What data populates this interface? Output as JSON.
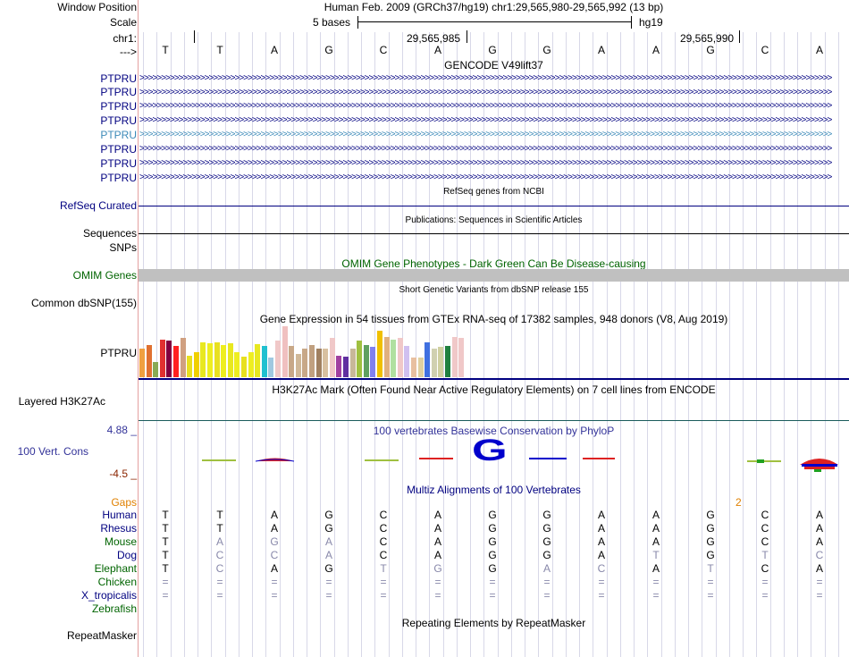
{
  "labels": {
    "window_position": "Window Position",
    "scale": "Scale",
    "chrom": "chr1:",
    "strand": "--->",
    "gencode_items": [
      "PTPRU",
      "PTPRU",
      "PTPRU",
      "PTPRU",
      "PTPRU",
      "PTPRU",
      "PTPRU",
      "PTPRU"
    ],
    "refseq": "RefSeq Curated",
    "sequences": "Sequences",
    "snps": "SNPs",
    "omim": "OMIM Genes",
    "common_dbsnp": "Common dbSNP(155)",
    "gtex_gene": "PTPRU",
    "h3k27ac": "Layered H3K27Ac",
    "phylop_max": "4.88 _",
    "cons": "100 Vert. Cons",
    "phylop_min": "-4.5 _",
    "gaps": "Gaps",
    "species": [
      "Human",
      "Rhesus",
      "Mouse",
      "Dog",
      "Elephant",
      "Chicken",
      "X_tropicalis",
      "Zebrafish"
    ],
    "repeatmasker": "RepeatMasker"
  },
  "header": {
    "position_text": "Human Feb. 2009 (GRCh37/hg19)   chr1:29,565,980-29,565,992 (13 bp)",
    "scale_bases": "5 bases",
    "scale_db": "hg19",
    "coord_1": "29,565,985",
    "coord_2": "29,565,990"
  },
  "bases": [
    "T",
    "T",
    "A",
    "G",
    "C",
    "A",
    "G",
    "G",
    "A",
    "A",
    "G",
    "C",
    "A"
  ],
  "tracks": {
    "gencode": "GENCODE V49lift37",
    "refseq": "RefSeq genes from NCBI",
    "publications": "Publications: Sequences in Scientific Articles",
    "omim": "OMIM Gene Phenotypes - Dark Green Can Be Disease-causing",
    "dbsnp": "Short Genetic Variants from dbSNP release 155",
    "gtex": "Gene Expression in 54 tissues from GTEx RNA-seq of 17382 samples, 948 donors (V8, Aug 2019)",
    "h3k27ac": "H3K27Ac Mark (Often Found Near Active Regulatory Elements) on 7 cell lines from ENCODE",
    "phylop": "100 vertebrates Basewise Conservation by PhyloP",
    "multiz": "Multiz Alignments of 100 Vertebrates",
    "gap_count": "2",
    "repeatmasker": "Repeating Elements by RepeatMasker",
    "phylop_big_base": "G"
  },
  "colors": {
    "label_blue": "#000080",
    "omim_green": "#006400",
    "gaps_orange": "#e08000",
    "cons_label": "#333399",
    "phylop_min": "#8b2500"
  },
  "gtex_bars": [
    {
      "v": 0.55,
      "c": "#f0a040"
    },
    {
      "v": 0.62,
      "c": "#e07030"
    },
    {
      "v": 0.3,
      "c": "#88aa55"
    },
    {
      "v": 0.72,
      "c": "#e03030"
    },
    {
      "v": 0.7,
      "c": "#800040"
    },
    {
      "v": 0.6,
      "c": "#ff2020"
    },
    {
      "v": 0.75,
      "c": "#d0a080"
    },
    {
      "v": 0.42,
      "c": "#e8e020"
    },
    {
      "v": 0.48,
      "c": "#f0d000"
    },
    {
      "v": 0.68,
      "c": "#e8e820"
    },
    {
      "v": 0.65,
      "c": "#eeee20"
    },
    {
      "v": 0.68,
      "c": "#e8e020"
    },
    {
      "v": 0.62,
      "c": "#eeee20"
    },
    {
      "v": 0.66,
      "c": "#e8e820"
    },
    {
      "v": 0.48,
      "c": "#eeee20"
    },
    {
      "v": 0.4,
      "c": "#e8e020"
    },
    {
      "v": 0.48,
      "c": "#eeee20"
    },
    {
      "v": 0.64,
      "c": "#e8e820"
    },
    {
      "v": 0.6,
      "c": "#20c0d0"
    },
    {
      "v": 0.38,
      "c": "#a0c8e0"
    },
    {
      "v": 0.7,
      "c": "#f0c8c8"
    },
    {
      "v": 0.98,
      "c": "#f0c0c0"
    },
    {
      "v": 0.6,
      "c": "#c8a888"
    },
    {
      "v": 0.45,
      "c": "#d0b898"
    },
    {
      "v": 0.55,
      "c": "#c8a888"
    },
    {
      "v": 0.62,
      "c": "#c0a080"
    },
    {
      "v": 0.55,
      "c": "#a08060"
    },
    {
      "v": 0.55,
      "c": "#d8c0a0"
    },
    {
      "v": 0.75,
      "c": "#f0c8c8"
    },
    {
      "v": 0.42,
      "c": "#a040a0"
    },
    {
      "v": 0.4,
      "c": "#6030a0"
    },
    {
      "v": 0.55,
      "c": "#c8b898"
    },
    {
      "v": 0.7,
      "c": "#a0c040"
    },
    {
      "v": 0.62,
      "c": "#60a060"
    },
    {
      "v": 0.58,
      "c": "#8080f0"
    },
    {
      "v": 0.9,
      "c": "#f0c000"
    },
    {
      "v": 0.78,
      "c": "#e0b080"
    },
    {
      "v": 0.72,
      "c": "#b0e0a0"
    },
    {
      "v": 0.75,
      "c": "#f0c8c8"
    },
    {
      "v": 0.6,
      "c": "#d0c0f0"
    },
    {
      "v": 0.38,
      "c": "#e8c0a0"
    },
    {
      "v": 0.38,
      "c": "#e0d0a0"
    },
    {
      "v": 0.68,
      "c": "#4070e0"
    },
    {
      "v": 0.55,
      "c": "#d0d0b0"
    },
    {
      "v": 0.58,
      "c": "#d0d0a0"
    },
    {
      "v": 0.6,
      "c": "#208040"
    },
    {
      "v": 0.78,
      "c": "#f0c8c8"
    },
    {
      "v": 0.75,
      "c": "#f0c8c8"
    }
  ],
  "alignment": {
    "Human": [
      "T",
      "T",
      "A",
      "G",
      "C",
      "A",
      "G",
      "G",
      "A",
      "A",
      "G",
      "C",
      "A"
    ],
    "Rhesus": [
      "T",
      "T",
      "A",
      "G",
      "C",
      "A",
      "G",
      "G",
      "A",
      "A",
      "G",
      "C",
      "A"
    ],
    "Mouse": [
      "T",
      "A",
      "G",
      "A",
      "C",
      "A",
      "G",
      "G",
      "A",
      "A",
      "G",
      "C",
      "A"
    ],
    "Dog": [
      "T",
      "C",
      "C",
      "A",
      "C",
      "A",
      "G",
      "G",
      "A",
      "T",
      "G",
      "T",
      "C"
    ],
    "Elephant": [
      "T",
      "C",
      "A",
      "G",
      "T",
      "G",
      "G",
      "A",
      "C",
      "A",
      "T",
      "C",
      "A"
    ],
    "Chicken": [
      "=",
      "=",
      "=",
      "=",
      "=",
      "=",
      "=",
      "=",
      "=",
      "=",
      "=",
      "=",
      "="
    ],
    "X_tropicalis": [
      "=",
      "=",
      "=",
      "=",
      "=",
      "=",
      "=",
      "=",
      "=",
      "=",
      "=",
      "=",
      "="
    ]
  },
  "alignment_match_mask": {
    "Mouse": [
      1,
      0,
      0,
      0,
      1,
      1,
      1,
      1,
      1,
      1,
      1,
      1,
      1
    ],
    "Dog": [
      1,
      0,
      0,
      0,
      1,
      1,
      1,
      1,
      1,
      0,
      1,
      0,
      0
    ],
    "Elephant": [
      1,
      0,
      1,
      1,
      0,
      0,
      1,
      0,
      0,
      1,
      0,
      1,
      1
    ]
  }
}
